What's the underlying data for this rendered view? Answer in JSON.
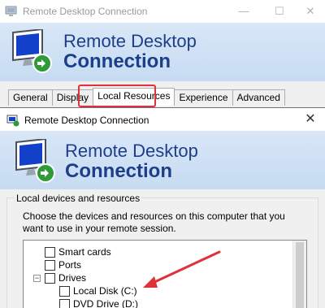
{
  "back_window": {
    "title": "Remote Desktop Connection",
    "controls": {
      "minimize": "—",
      "maximize": "☐",
      "close": "✕"
    },
    "banner": {
      "line1": "Remote Desktop",
      "line2": "Connection"
    },
    "tabs": [
      {
        "label": "General"
      },
      {
        "label": "Display"
      },
      {
        "label": "Local Resources"
      },
      {
        "label": "Experience"
      },
      {
        "label": "Advanced"
      }
    ],
    "active_tab": "Local Resources"
  },
  "front_window": {
    "title": "Remote Desktop Connection",
    "close": "✕",
    "banner": {
      "line1": "Remote Desktop",
      "line2": "Connection"
    },
    "group_label": "Local devices and resources",
    "description": "Choose the devices and resources on this computer that you want to use in your remote session.",
    "tree": [
      {
        "label": "Smart cards",
        "checked": false
      },
      {
        "label": "Ports",
        "checked": false
      },
      {
        "label": "Drives",
        "checked": false,
        "expander": "−"
      },
      {
        "label": "Local Disk (C:)",
        "checked": false
      },
      {
        "label": "DVD Drive (D:)",
        "checked": false
      }
    ]
  },
  "colors": {
    "highlight": "#e0313b",
    "banner_text": "#1d3e8a",
    "banner_bg": "#d9e7f7"
  }
}
